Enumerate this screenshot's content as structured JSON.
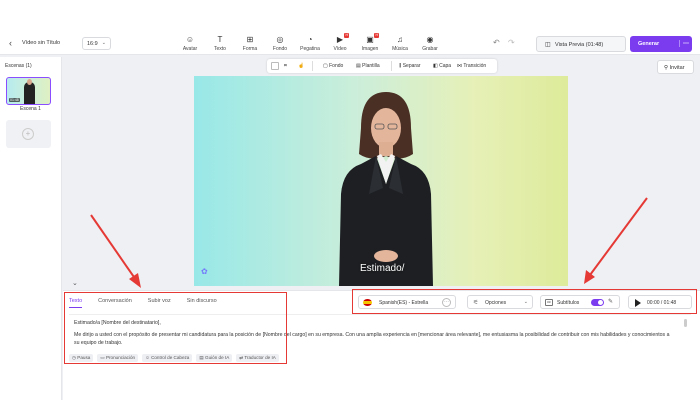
{
  "header": {
    "back_icon": "chevron-left-icon",
    "title": "Vídeo sin Título",
    "aspect_ratio": "16:9",
    "tools": [
      {
        "label": "Avatar",
        "icon": "avatar-icon"
      },
      {
        "label": "Texto",
        "icon": "text-icon"
      },
      {
        "label": "Forma",
        "icon": "shapes-icon"
      },
      {
        "label": "Fondo",
        "icon": "background-icon"
      },
      {
        "label": "Pegatina",
        "icon": "sticker-icon"
      },
      {
        "label": "Vídeo",
        "icon": "video-icon",
        "badge": "H"
      },
      {
        "label": "Imagen",
        "icon": "image-icon",
        "badge": "H"
      },
      {
        "label": "Música",
        "icon": "music-icon"
      },
      {
        "label": "Grabar",
        "icon": "record-icon"
      }
    ],
    "preview_label": "Vista Previa (01:48)",
    "generate_label": "Generar"
  },
  "sidebar": {
    "scenes_label": "Escenas (1)",
    "scene_duration": "01:48",
    "scene_label": "Escena 1",
    "add_scene_symbol": "+"
  },
  "canvas_toolbar": {
    "items": [
      "Fondo",
      "Plantilla",
      "Separar",
      "Capa",
      "Transición"
    ]
  },
  "invite_label": "Invitar",
  "stage": {
    "caption": "Estimado/",
    "colors": {
      "left": "#98e8e8",
      "right": "#ddeb9a"
    }
  },
  "script_panel": {
    "tabs": [
      "Texto",
      "Conversación",
      "Subir voz",
      "Sin discurso"
    ],
    "active_tab": "Texto",
    "voice": "Spanish(ES) - Estrella",
    "options_label": "Opciones",
    "subtitles_label": "Subtítulos",
    "subtitles_on": true,
    "time": "00:00 / 01:48",
    "lines": [
      "Estimado/a [Nombre del destinatario],",
      "Me dirijo a usted con el propósito de presentar mi candidatura para la posición de [Nombre del cargo] en su empresa. Con una amplia experiencia en [mencionar área relevante], me entusiasma la posibilidad de contribuir con mis habilidades y conocimientos a su equipo de trabajo."
    ],
    "chips": [
      "Pausa",
      "Pronunciación",
      "Control de Cabeza",
      "Guión de IA",
      "Traductor de IA"
    ]
  },
  "colors": {
    "accent": "#7b3cf0",
    "highlight": "#e53935"
  }
}
